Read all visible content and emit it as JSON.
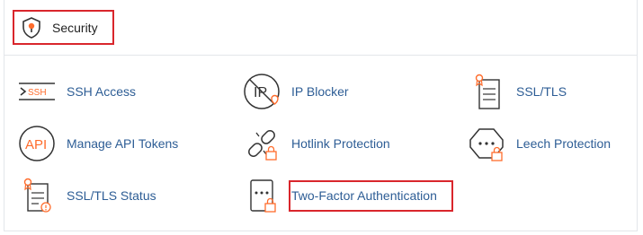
{
  "section": {
    "title": "Security",
    "icon": "shield-icon"
  },
  "items": [
    {
      "label": "SSH Access",
      "icon": "ssh-terminal-icon"
    },
    {
      "label": "IP Blocker",
      "icon": "ip-blocker-icon"
    },
    {
      "label": "SSL/TLS",
      "icon": "ssl-certificate-icon"
    },
    {
      "label": "Manage API Tokens",
      "icon": "api-icon"
    },
    {
      "label": "Hotlink Protection",
      "icon": "broken-chain-lock-icon"
    },
    {
      "label": "Leech Protection",
      "icon": "password-lock-icon"
    },
    {
      "label": "SSL/TLS Status",
      "icon": "ssl-status-certificate-icon"
    },
    {
      "label": "Two-Factor Authentication",
      "icon": "two-factor-lock-icon"
    }
  ],
  "colors": {
    "link": "#2d5d95",
    "accent": "#ff6c2c",
    "highlight": "#d9262c"
  }
}
